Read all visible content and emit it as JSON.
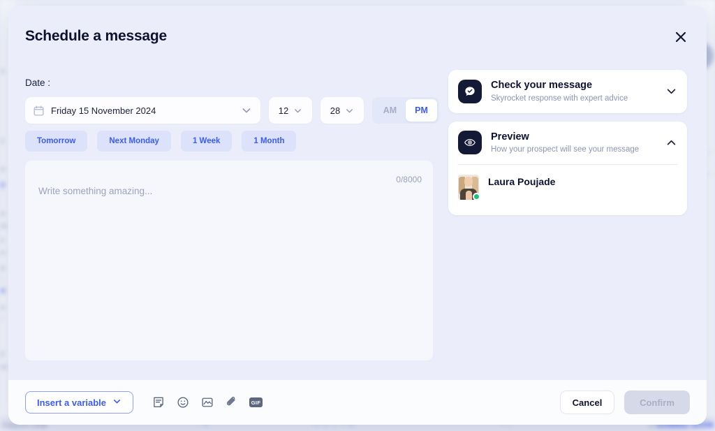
{
  "background": {
    "left_snippets": [
      "s",
      "c",
      "o",
      "y",
      "e",
      "m",
      "c",
      "n",
      "e",
      ":",
      "a",
      "u",
      ":",
      "y",
      "nl"
    ],
    "right_snippets": [
      "e",
      "le",
      "fre",
      "in",
      "ala",
      "ane",
      "vor",
      "ane",
      "vor",
      "nh",
      "an-",
      "vor"
    ],
    "bottom_left_label": "support chat",
    "bottom_note_label": "Note",
    "bottom_right_label": "COMING SOON"
  },
  "modal": {
    "title": "Schedule a message",
    "close_icon": "close-icon",
    "date": {
      "label": "Date :",
      "calendar_icon": "calendar-icon",
      "value": "Friday 15 November 2024",
      "dropdown_icon": "chevron-down-icon",
      "hour": "12",
      "minute": "28",
      "meridiem_options": [
        "AM",
        "PM"
      ],
      "meridiem_selected": "PM"
    },
    "quick_chips": [
      {
        "label": "Tomorrow"
      },
      {
        "label": "Next Monday"
      },
      {
        "label": "1 Week"
      },
      {
        "label": "1 Month"
      }
    ],
    "composer": {
      "placeholder": "Write something amazing...",
      "value": "",
      "counter": "0/8000"
    },
    "panels": [
      {
        "id": "check-your-message",
        "icon": "message-check-icon",
        "title": "Check your message",
        "subtitle": "Skyrocket response with expert advice",
        "toggle_icon": "chevron-down-icon",
        "expanded": false
      },
      {
        "id": "preview",
        "icon": "eye-icon",
        "title": "Preview",
        "subtitle": "How your prospect will see your message",
        "toggle_icon": "chevron-up-icon",
        "expanded": true,
        "contact": {
          "name": "Laura Poujade",
          "avatar": "avatar-photo",
          "status": "online"
        }
      }
    ],
    "footer": {
      "insert_variable_label": "Insert a variable",
      "insert_variable_icon": "chevron-down-icon",
      "tools": [
        {
          "name": "template-note-icon"
        },
        {
          "name": "emoji-icon"
        },
        {
          "name": "image-icon"
        },
        {
          "name": "attachment-icon"
        },
        {
          "name": "gif-icon",
          "label": "GIF"
        }
      ],
      "cancel_label": "Cancel",
      "confirm_label": "Confirm",
      "confirm_disabled": true
    }
  },
  "colors": {
    "accent_blue": "#3b5bfd",
    "modal_body": "#ebeefa",
    "footer": "#fbfcfe",
    "chip_bg": "#dbe2fa",
    "icon_dark": "#141936",
    "online_green": "#19c37d"
  }
}
